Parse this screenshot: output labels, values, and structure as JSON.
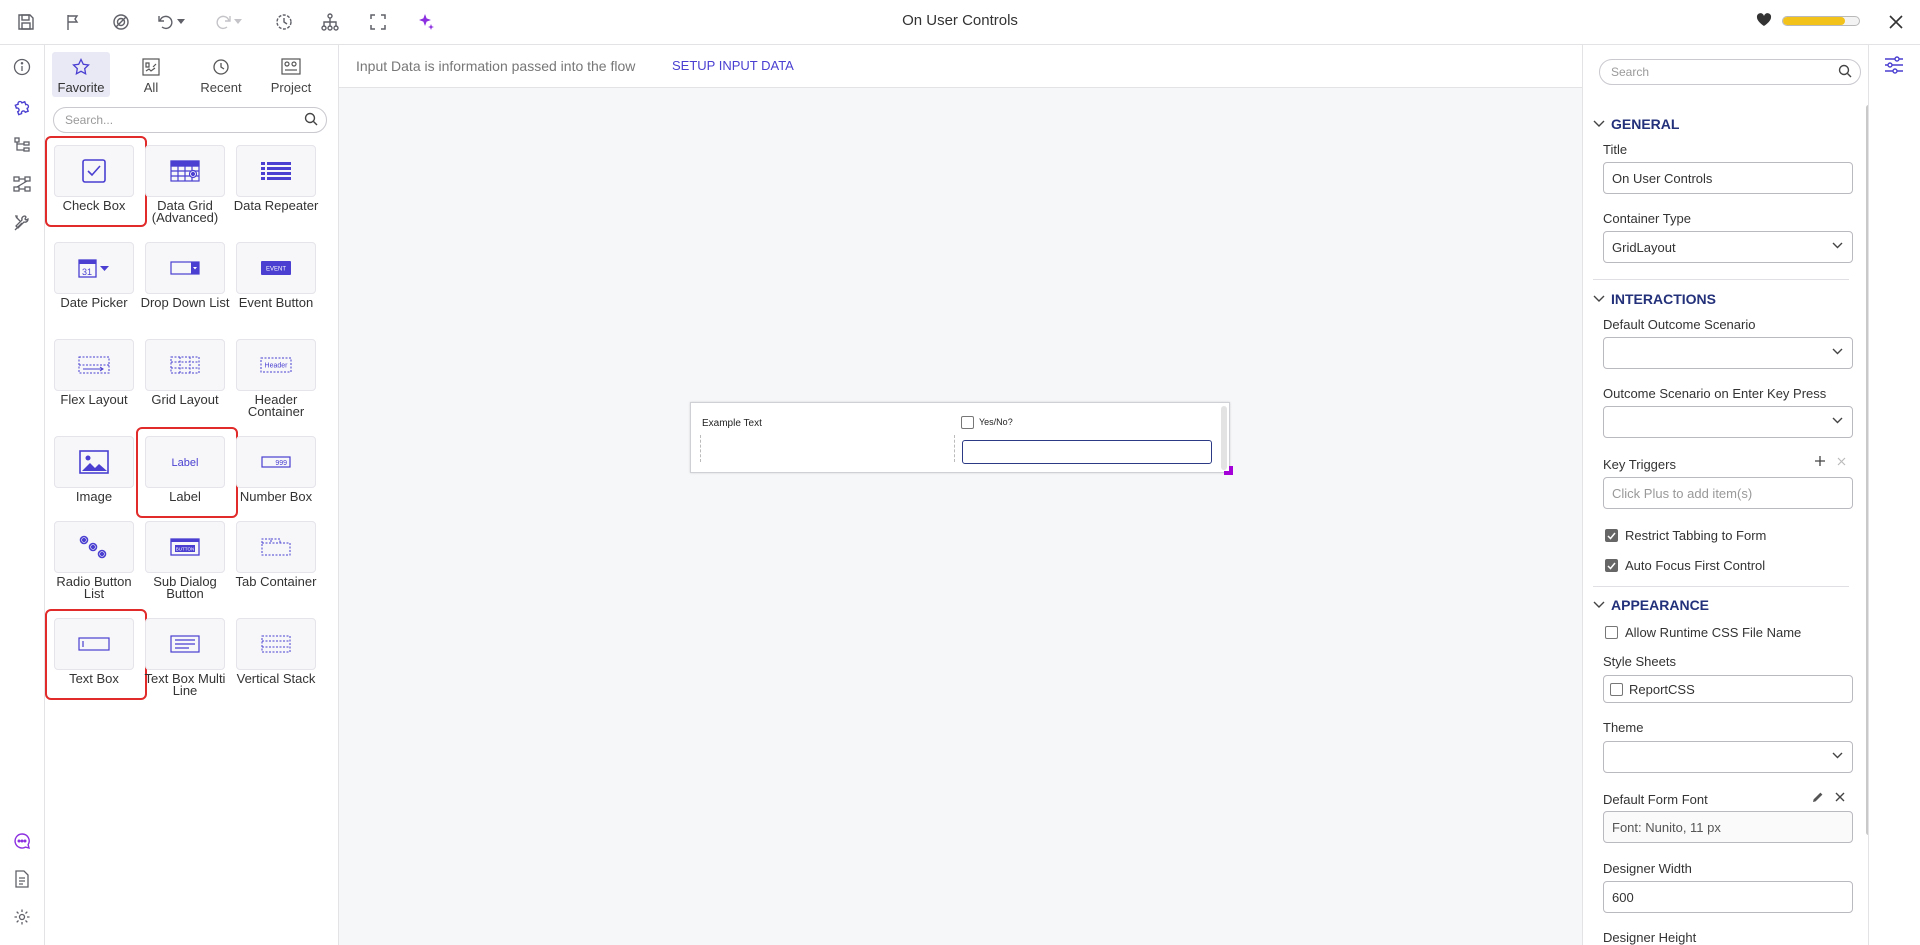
{
  "window": {
    "title": "On User Controls",
    "progress_fraction": 0.82,
    "colors": {
      "accent": "#4a3fd1",
      "highlight": "#e12a2a",
      "progress": "#f2c11a",
      "resize_handle": "#a400d8"
    }
  },
  "toolbar_icons": [
    "save-icon",
    "flag-icon",
    "debug-icon",
    "undo-icon",
    "redo-icon",
    "history-icon",
    "hierarchy-icon",
    "fullscreen-icon",
    "sparkle-icon"
  ],
  "left_rail_icons": [
    "info-icon",
    "puzzle-icon",
    "tree-icon",
    "flow-icon",
    "tools-icon",
    "chat-icon",
    "document-icon",
    "gear-settings-icon"
  ],
  "toolbox": {
    "tabs": [
      {
        "label": "Favorite",
        "icon": "star-icon",
        "active": true
      },
      {
        "label": "All",
        "icon": "all-icon",
        "active": false
      },
      {
        "label": "Recent",
        "icon": "clock-icon",
        "active": false
      },
      {
        "label": "Project",
        "icon": "project-icon",
        "active": false
      }
    ],
    "search_placeholder": "Search...",
    "items": [
      {
        "label": "Check Box",
        "icon": "checkbox-icon",
        "highlighted": true
      },
      {
        "label": "Data Grid (Advanced)",
        "icon": "data-grid-icon",
        "highlighted": false
      },
      {
        "label": "Data Repeater",
        "icon": "data-repeater-icon",
        "highlighted": false
      },
      {
        "label": "Date Picker",
        "icon": "date-picker-icon",
        "highlighted": false
      },
      {
        "label": "Drop Down List",
        "icon": "dropdown-list-icon",
        "highlighted": false
      },
      {
        "label": "Event Button",
        "icon": "event-button-icon",
        "highlighted": false
      },
      {
        "label": "Flex Layout",
        "icon": "flex-layout-icon",
        "highlighted": false
      },
      {
        "label": "Grid Layout",
        "icon": "grid-layout-icon",
        "highlighted": false
      },
      {
        "label": "Header Container",
        "icon": "header-container-icon",
        "highlighted": false
      },
      {
        "label": "Image",
        "icon": "image-icon",
        "highlighted": false
      },
      {
        "label": "Label",
        "icon": "label-icon",
        "highlighted": true
      },
      {
        "label": "Number Box",
        "icon": "number-box-icon",
        "highlighted": false
      },
      {
        "label": "Radio Button List",
        "icon": "radio-list-icon",
        "highlighted": false
      },
      {
        "label": "Sub Dialog Button",
        "icon": "sub-dialog-icon",
        "highlighted": false
      },
      {
        "label": "Tab Container",
        "icon": "tab-container-icon",
        "highlighted": false
      },
      {
        "label": "Text Box",
        "icon": "text-box-icon",
        "highlighted": true
      },
      {
        "label": "Text Box Multi Line",
        "icon": "multiline-text-icon",
        "highlighted": false
      },
      {
        "label": "Vertical Stack",
        "icon": "vertical-stack-icon",
        "highlighted": false
      }
    ],
    "icon_text": {
      "event": "EVENT",
      "header": "Header",
      "label": "Label",
      "number": "999",
      "button": "BUTTON",
      "calendar_day": "31"
    }
  },
  "canvas": {
    "info_text": "Input Data is information passed into the flow",
    "info_link": "SETUP INPUT DATA",
    "form": {
      "label_text": "Example Text",
      "checkbox_label": "Yes/No?",
      "input_value": ""
    }
  },
  "properties": {
    "search_placeholder": "Search",
    "general": {
      "header": "GENERAL",
      "title_label": "Title",
      "title_value": "On User Controls",
      "container_type_label": "Container Type",
      "container_type_value": "GridLayout"
    },
    "interactions": {
      "header": "INTERACTIONS",
      "default_outcome_label": "Default Outcome Scenario",
      "default_outcome_value": "",
      "enter_key_label": "Outcome Scenario on Enter Key Press",
      "enter_key_value": "",
      "key_triggers_label": "Key Triggers",
      "key_triggers_placeholder": "Click Plus to add item(s)",
      "restrict_tabbing_label": "Restrict Tabbing to Form",
      "restrict_tabbing_checked": true,
      "auto_focus_label": "Auto Focus First Control",
      "auto_focus_checked": true
    },
    "appearance": {
      "header": "APPEARANCE",
      "allow_css_label": "Allow Runtime CSS File Name",
      "allow_css_checked": false,
      "style_sheets_label": "Style Sheets",
      "style_sheet_item": "ReportCSS",
      "style_sheet_checked": false,
      "theme_label": "Theme",
      "theme_value": "",
      "default_font_label": "Default Form Font",
      "default_font_value": "Font: Nunito, 11 px",
      "designer_width_label": "Designer Width",
      "designer_width_value": "600",
      "designer_height_label": "Designer Height"
    }
  }
}
